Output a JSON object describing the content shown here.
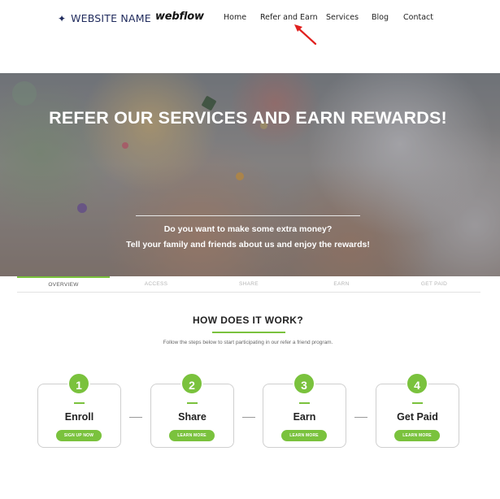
{
  "header": {
    "brand_icon": "sparkle-icon",
    "brand_name": "WEBSITE NAME",
    "platform_logo": "webflow",
    "nav": [
      "Home",
      "Refer and Earn",
      "Services",
      "Blog",
      "Contact"
    ],
    "annotation_icon": "red-arrow-icon"
  },
  "hero": {
    "title": "REFER OUR SERVICES AND EARN REWARDS!",
    "subtitle_line1": "Do you want to make some extra money?",
    "subtitle_line2": "Tell your family and friends about us and enjoy the rewards!"
  },
  "tabs": [
    "OVERVIEW",
    "ACCESS",
    "SHARE",
    "EARN",
    "GET PAID"
  ],
  "how": {
    "title": "HOW DOES IT WORK?",
    "description": "Follow the steps below to start participating in our refer a friend program.",
    "steps": [
      {
        "number": "1",
        "title": "Enroll",
        "button": "SIGN UP NOW"
      },
      {
        "number": "2",
        "title": "Share",
        "button": "LEARN MORE"
      },
      {
        "number": "3",
        "title": "Earn",
        "button": "LEARN MORE"
      },
      {
        "number": "4",
        "title": "Get Paid",
        "button": "LEARN MORE"
      }
    ]
  },
  "colors": {
    "accent": "#7ac23d",
    "brand": "#1f2a5c",
    "annotation": "#e0201e"
  }
}
